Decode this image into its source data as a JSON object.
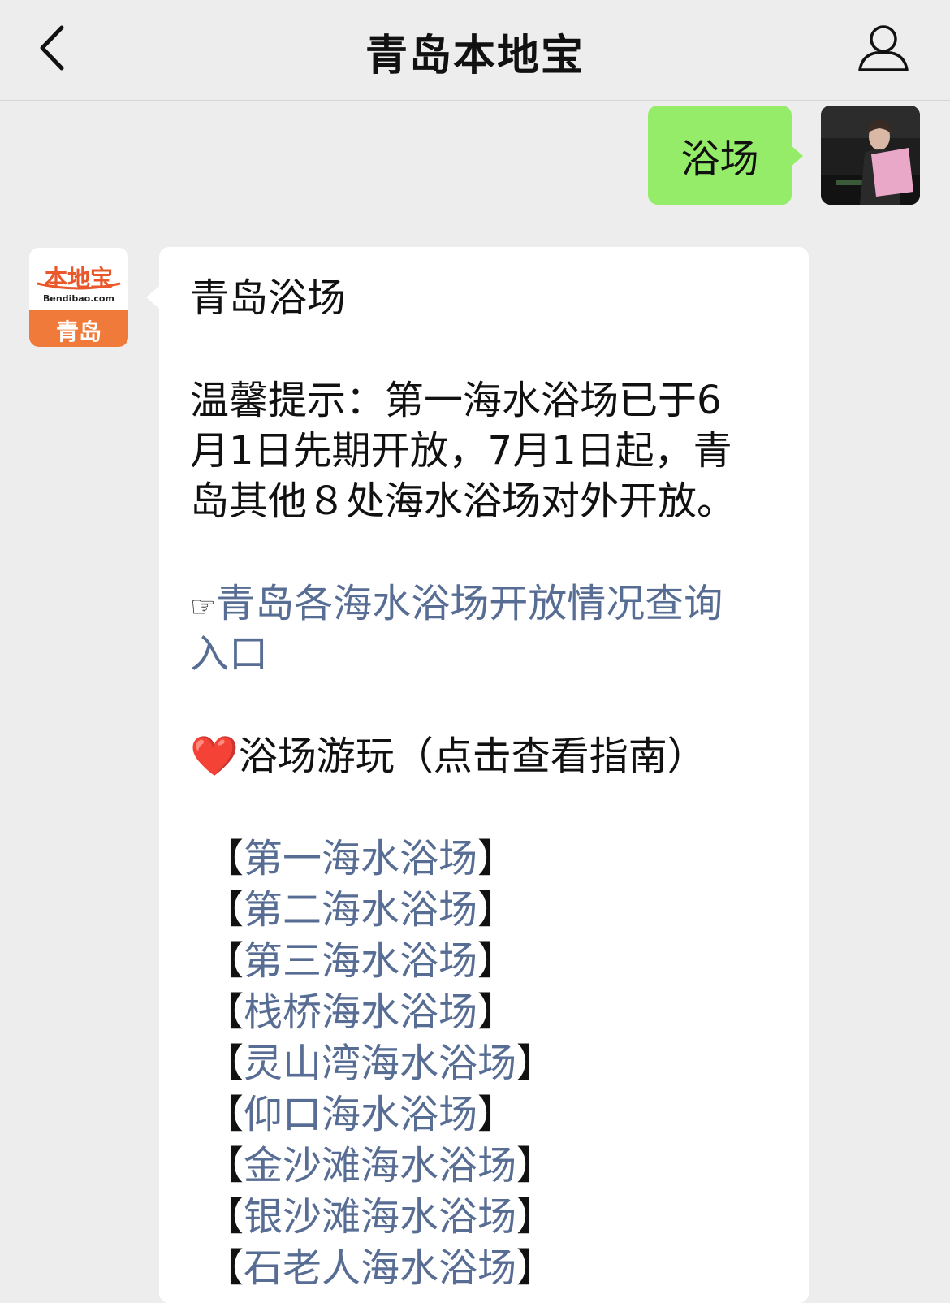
{
  "header": {
    "title": "青岛本地宝"
  },
  "messages": {
    "outgoing": {
      "text": "浴场"
    },
    "incoming": {
      "sender_logo": {
        "brand": "本地宝",
        "site": "Bendibao.com",
        "city": "青岛"
      },
      "heading": "青岛浴场",
      "tip_lines": [
        "温馨提示：第一海水浴场已于6",
        "月1日先期开放，7月1日起，青",
        "岛其他８处海水浴场对外开放。"
      ],
      "pointer_glyph": "☞",
      "query_link_lines": [
        "青岛各海水浴场开放情况查询",
        "入口"
      ],
      "heart_glyph": "❤️",
      "guide_heading": "浴场游玩（点击查看指南）",
      "bracket_open": "【",
      "bracket_close": "】",
      "beaches": [
        "第一海水浴场",
        "第二海水浴场",
        "第三海水浴场",
        "栈桥海水浴场",
        "灵山湾海水浴场",
        "仰口海水浴场",
        "金沙滩海水浴场",
        "银沙滩海水浴场",
        "石老人海水浴场"
      ]
    }
  },
  "colors": {
    "background": "#ededed",
    "outgoing_bubble": "#95ec69",
    "incoming_bubble": "#ffffff",
    "link": "#586d94",
    "logo_red": "#e9572b",
    "logo_orange": "#f07a3a"
  }
}
